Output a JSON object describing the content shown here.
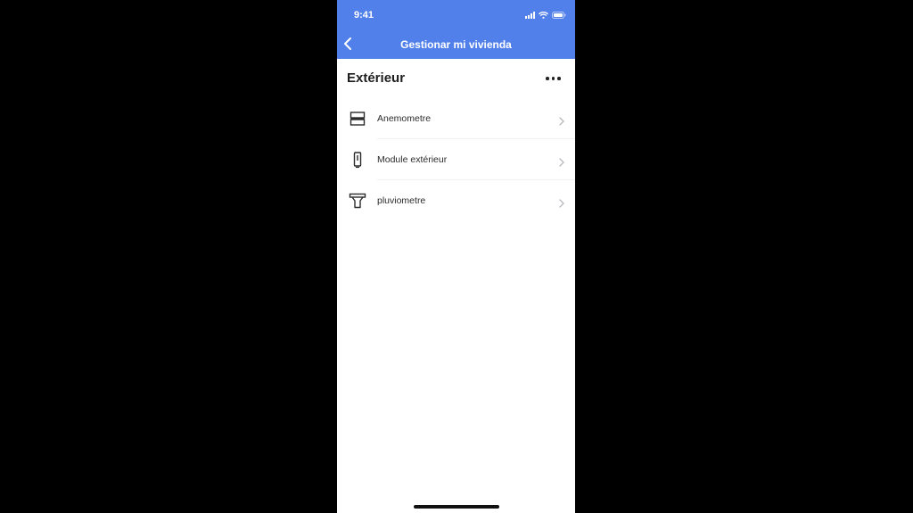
{
  "status_bar": {
    "time": "9:41"
  },
  "header": {
    "title": "Gestionar mi vivienda",
    "back_icon": "chevron-left-icon",
    "accent": "#5280ea"
  },
  "section": {
    "title": "Extérieur",
    "more_icon": "more-horizontal-icon"
  },
  "devices": [
    {
      "label": "Anemometre",
      "icon": "anemometer-icon"
    },
    {
      "label": "Module extérieur",
      "icon": "outdoor-module-icon"
    },
    {
      "label": "pluviometre",
      "icon": "rain-gauge-icon"
    }
  ]
}
